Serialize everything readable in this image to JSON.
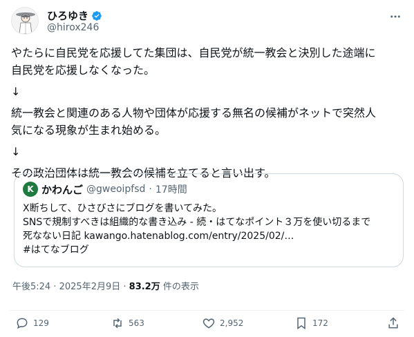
{
  "author": {
    "display_name": "ひろゆき",
    "handle": "@hirox246",
    "verified_icon": "verified-badge-icon",
    "avatar": "avatar-illustration"
  },
  "tweet": {
    "lines": [
      "やたらに自民党を応援してた集団は、自民党が統一教会と決別した途端に",
      "自民党を応援しなくなった。",
      "↓",
      "統一教会と関連のある人物や団体が応援する無名の候補がネットで突然人",
      "気になる現象が生まれ始める。",
      "↓",
      "その政治団体は統一教会の候補を立てると言い出す。"
    ]
  },
  "quote": {
    "avatar_letter": "K",
    "display_name": "かわんご",
    "handle": "@gweoipfsd",
    "separator": "·",
    "time": "17時間",
    "lines": [
      "X断ちして、ひさびさにブログを書いてみた。",
      "SNSで規制すべきは組織的な書き込み - 続・はてなポイント３万を使い切るまで",
      "死なない日記 kawango.hatenablog.com/entry/2025/02/…",
      "#はてなブログ"
    ]
  },
  "meta": {
    "time": "午後5:24",
    "date": "2025年2月9日",
    "views": "83.2万",
    "views_suffix": "件の表示"
  },
  "actions": {
    "replies": "129",
    "reposts": "563",
    "likes": "2,952",
    "bookmarks": "172"
  },
  "colors": {
    "text": "#0f1419",
    "secondary": "#536471",
    "verified": "#1d9bf0",
    "border": "#cfd9de"
  }
}
